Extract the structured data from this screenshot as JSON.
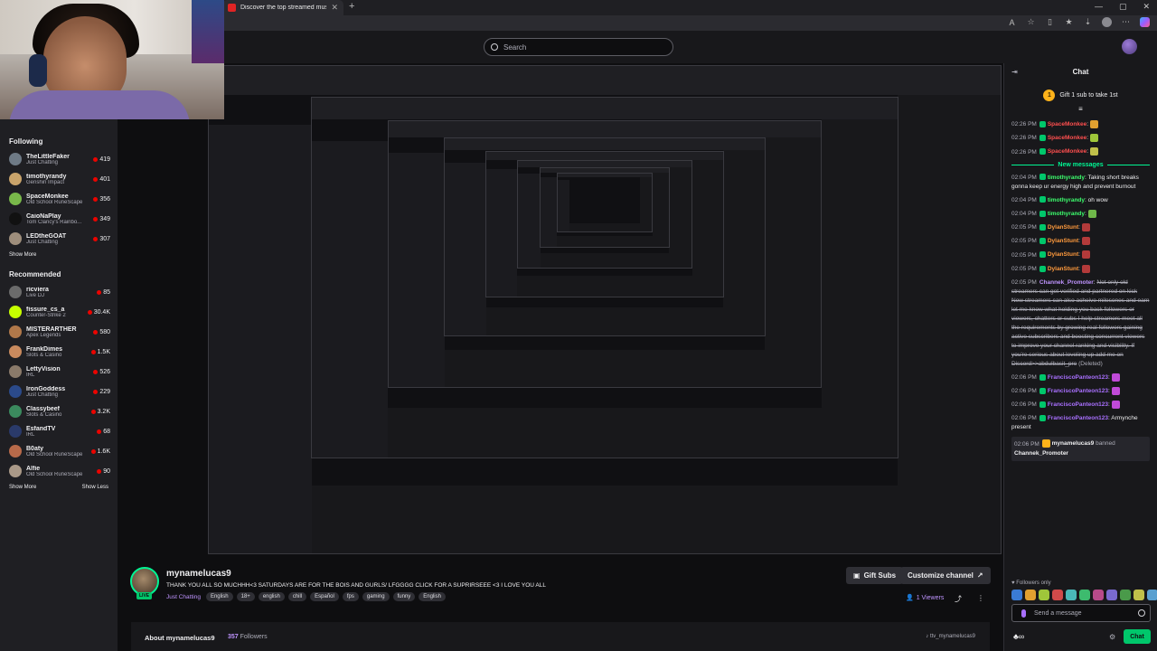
{
  "browser": {
    "tab_title": "Discover the top streamed music",
    "new_tab": "+",
    "window_controls": [
      "—",
      "▢",
      "✕"
    ]
  },
  "topnav": {
    "search_placeholder": "Search"
  },
  "sidebar": {
    "following_heading": "Following",
    "following": [
      {
        "name": "TheLittleFaker",
        "game": "Just Chatting",
        "viewers": "419",
        "color": "#6e7a86"
      },
      {
        "name": "timothyrandy",
        "game": "Genshin Impact",
        "viewers": "401",
        "color": "#c9a46b"
      },
      {
        "name": "SpaceMonkee",
        "game": "Old School RuneScape",
        "viewers": "356",
        "color": "#79b84a"
      },
      {
        "name": "CaioNaPlay",
        "game": "Tom Clancy's Rainbo...",
        "viewers": "349",
        "color": "#111111"
      },
      {
        "name": "LEDtheGOAT",
        "game": "Just Chatting",
        "viewers": "307",
        "color": "#9e8e7c"
      }
    ],
    "show_more": "Show More",
    "recommended_heading": "Recommended",
    "recommended": [
      {
        "name": "ricviera",
        "game": "Live DJ",
        "viewers": "85",
        "color": "#6b6b6b"
      },
      {
        "name": "fissure_cs_a",
        "game": "Counter-Strike 2",
        "viewers": "30.4K",
        "color": "#c7ff00"
      },
      {
        "name": "MISTERARTHER",
        "game": "Apex Legends",
        "viewers": "580",
        "color": "#b0784a"
      },
      {
        "name": "FrankDimes",
        "game": "Slots & Casino",
        "viewers": "1.5K",
        "color": "#c98a5e"
      },
      {
        "name": "LettyVision",
        "game": "IRL",
        "viewers": "526",
        "color": "#8a7a6a"
      },
      {
        "name": "IronGoddess",
        "game": "Just Chatting",
        "viewers": "229",
        "color": "#2b4a8a"
      },
      {
        "name": "Classybeef",
        "game": "Slots & Casino",
        "viewers": "3.2K",
        "color": "#3b8a5e"
      },
      {
        "name": "EsfandTV",
        "game": "IRL",
        "viewers": "68",
        "color": "#2a3a6a"
      },
      {
        "name": "B0aty",
        "game": "Old School RuneScape",
        "viewers": "1.6K",
        "color": "#b86a4a"
      },
      {
        "name": "Alfie",
        "game": "Old School RuneScape",
        "viewers": "90",
        "color": "#aa9988"
      }
    ],
    "show_more_2": "Show More",
    "show_less": "Show Less"
  },
  "stream": {
    "streamer": "mynamelucas9",
    "live_badge": "LIVE",
    "title": "THANK YOU ALL SO MUCHHH<3 SATURDAYS ARE FOR THE BOIS AND GURLS/ LFGGGG CLICK FOR A SUPRIRSEEE <3 I LOVE YOU ALL",
    "category": "Just Chatting",
    "tags": [
      "English",
      "18+",
      "english",
      "chill",
      "Español",
      "fps",
      "gaming",
      "funny",
      "English"
    ],
    "gift_subs": "Gift Subs",
    "customize": "Customize channel",
    "viewers": "1 Viewers",
    "about": "About mynamelucas9",
    "followers_count": "357",
    "followers_label": "Followers",
    "ttv": "ttv_mynamelucas9"
  },
  "chat": {
    "title": "Chat",
    "gift_banner": "Gift 1 sub to take 1st",
    "new_messages": "New messages",
    "messages": [
      {
        "ts": "02:26 PM",
        "user": "SpaceMonkee",
        "color": "#ff4f4f",
        "text": "",
        "emote": "#e0a030"
      },
      {
        "ts": "02:26 PM",
        "user": "SpaceMonkee",
        "color": "#ff4f4f",
        "text": "",
        "emote": "#9fc63a"
      },
      {
        "ts": "02:26 PM",
        "user": "SpaceMonkee",
        "color": "#ff4f4f",
        "text": "",
        "emote": "#c0c04a"
      }
    ],
    "messages2": [
      {
        "ts": "02:04 PM",
        "user": "timothyrandy",
        "color": "#3dff6e",
        "text": "Taking short breaks gonna keep ur energy high and prevent burnout",
        "emote": ""
      },
      {
        "ts": "02:04 PM",
        "user": "timothyrandy",
        "color": "#3dff6e",
        "text": "oh wow",
        "emote": ""
      },
      {
        "ts": "02:04 PM",
        "user": "timothyrandy",
        "color": "#3dff6e",
        "text": "",
        "emote": "#6fb84a"
      },
      {
        "ts": "02:05 PM",
        "user": "DylanStunt",
        "color": "#ff9a3d",
        "text": "",
        "emote": "#b33a3a"
      },
      {
        "ts": "02:05 PM",
        "user": "DylanStunt",
        "color": "#ff9a3d",
        "text": "",
        "emote": "#b33a3a"
      },
      {
        "ts": "02:05 PM",
        "user": "DylanStunt",
        "color": "#ff9a3d",
        "text": "",
        "emote": "#b33a3a"
      },
      {
        "ts": "02:05 PM",
        "user": "DylanStunt",
        "color": "#ff9a3d",
        "text": "",
        "emote": "#b33a3a"
      }
    ],
    "deleted": {
      "ts": "02:05 PM",
      "user": "Channek_Promoter",
      "text": "Not only old streamers can get verified and partnered on kick New streamers can also acheive milesones and earn let me know what holding you back followers or viewers, chatters or subs I help streamers meet all the requirements by growing real followers gaining active subscribers and boosting concurrent viewers to improve your channel ranking and visibility. If you're serious about leveling up add me on Discord>>abdulbasit_pro",
      "deleted_label": "(Deleted)"
    },
    "messages3": [
      {
        "ts": "02:06 PM",
        "user": "FranciscoPanteon123",
        "color": "#a970ff",
        "text": "",
        "emote": "#c04ad8"
      },
      {
        "ts": "02:06 PM",
        "user": "FranciscoPanteon123",
        "color": "#a970ff",
        "text": "",
        "emote": "#c04ad8"
      },
      {
        "ts": "02:06 PM",
        "user": "FranciscoPanteon123",
        "color": "#a970ff",
        "text": "",
        "emote": "#c04ad8"
      },
      {
        "ts": "02:06 PM",
        "user": "FranciscoPanteon123",
        "color": "#a970ff",
        "text": "Armynche present",
        "emote": ""
      }
    ],
    "banned": {
      "ts": "02:06 PM",
      "user": "mynamelucas9",
      "action": "banned",
      "target": "Channek_Promoter"
    },
    "followers_only": "Followers only",
    "send_placeholder": "Send a message",
    "chat_button": "Chat",
    "emote_colors": [
      "#3a7bd5",
      "#e0a030",
      "#9fc63a",
      "#d04a4a",
      "#4ab8b8",
      "#3dbb6e",
      "#b84a8a",
      "#7a6ad0",
      "#4a9a4a",
      "#c0c04a",
      "#5aa0d0"
    ]
  },
  "colors": {
    "accent": "#a970ff",
    "live_green": "#00c76b",
    "bg": "#0e0e10"
  }
}
